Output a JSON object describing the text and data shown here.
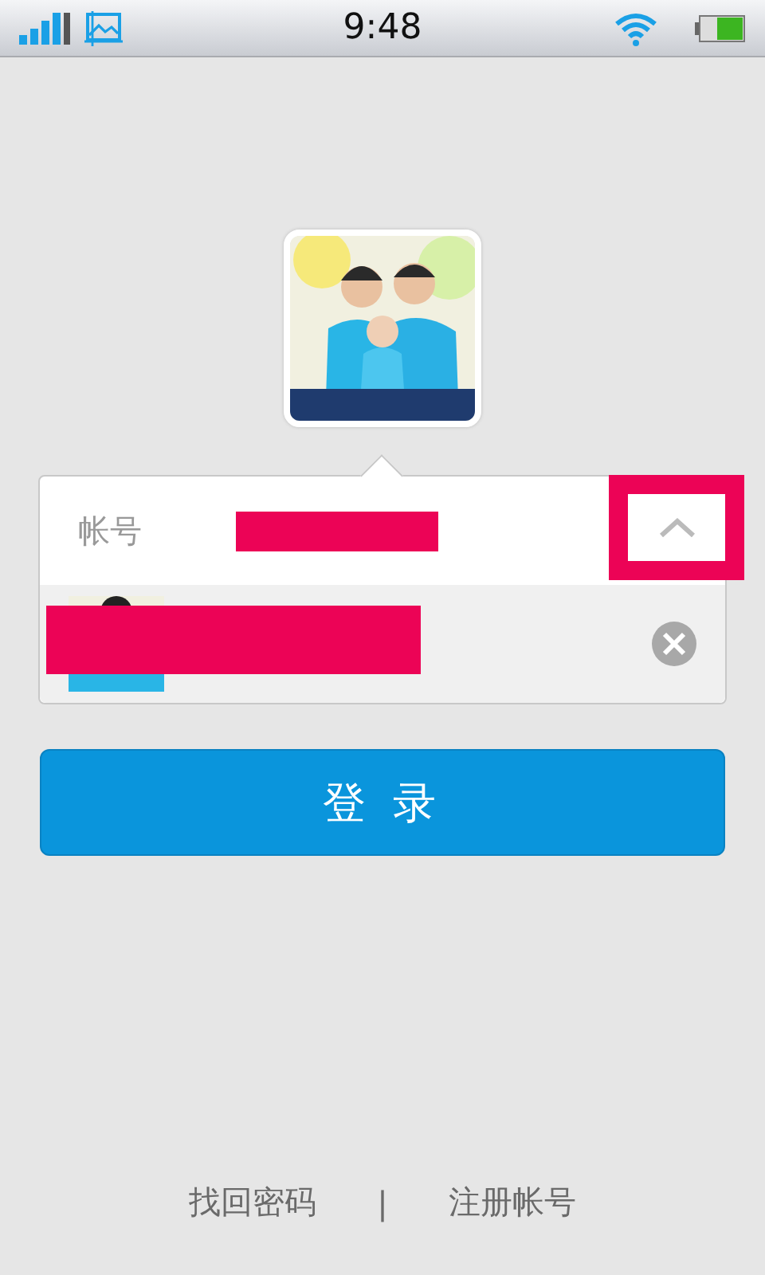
{
  "status_bar": {
    "time": "9:48"
  },
  "account_field": {
    "label": "帐号",
    "dropdown_expanded": true
  },
  "login_button": {
    "label": "登 录"
  },
  "links": [
    {
      "label": "找回密码"
    },
    {
      "label": "注册帐号"
    }
  ],
  "link_separator": "|"
}
